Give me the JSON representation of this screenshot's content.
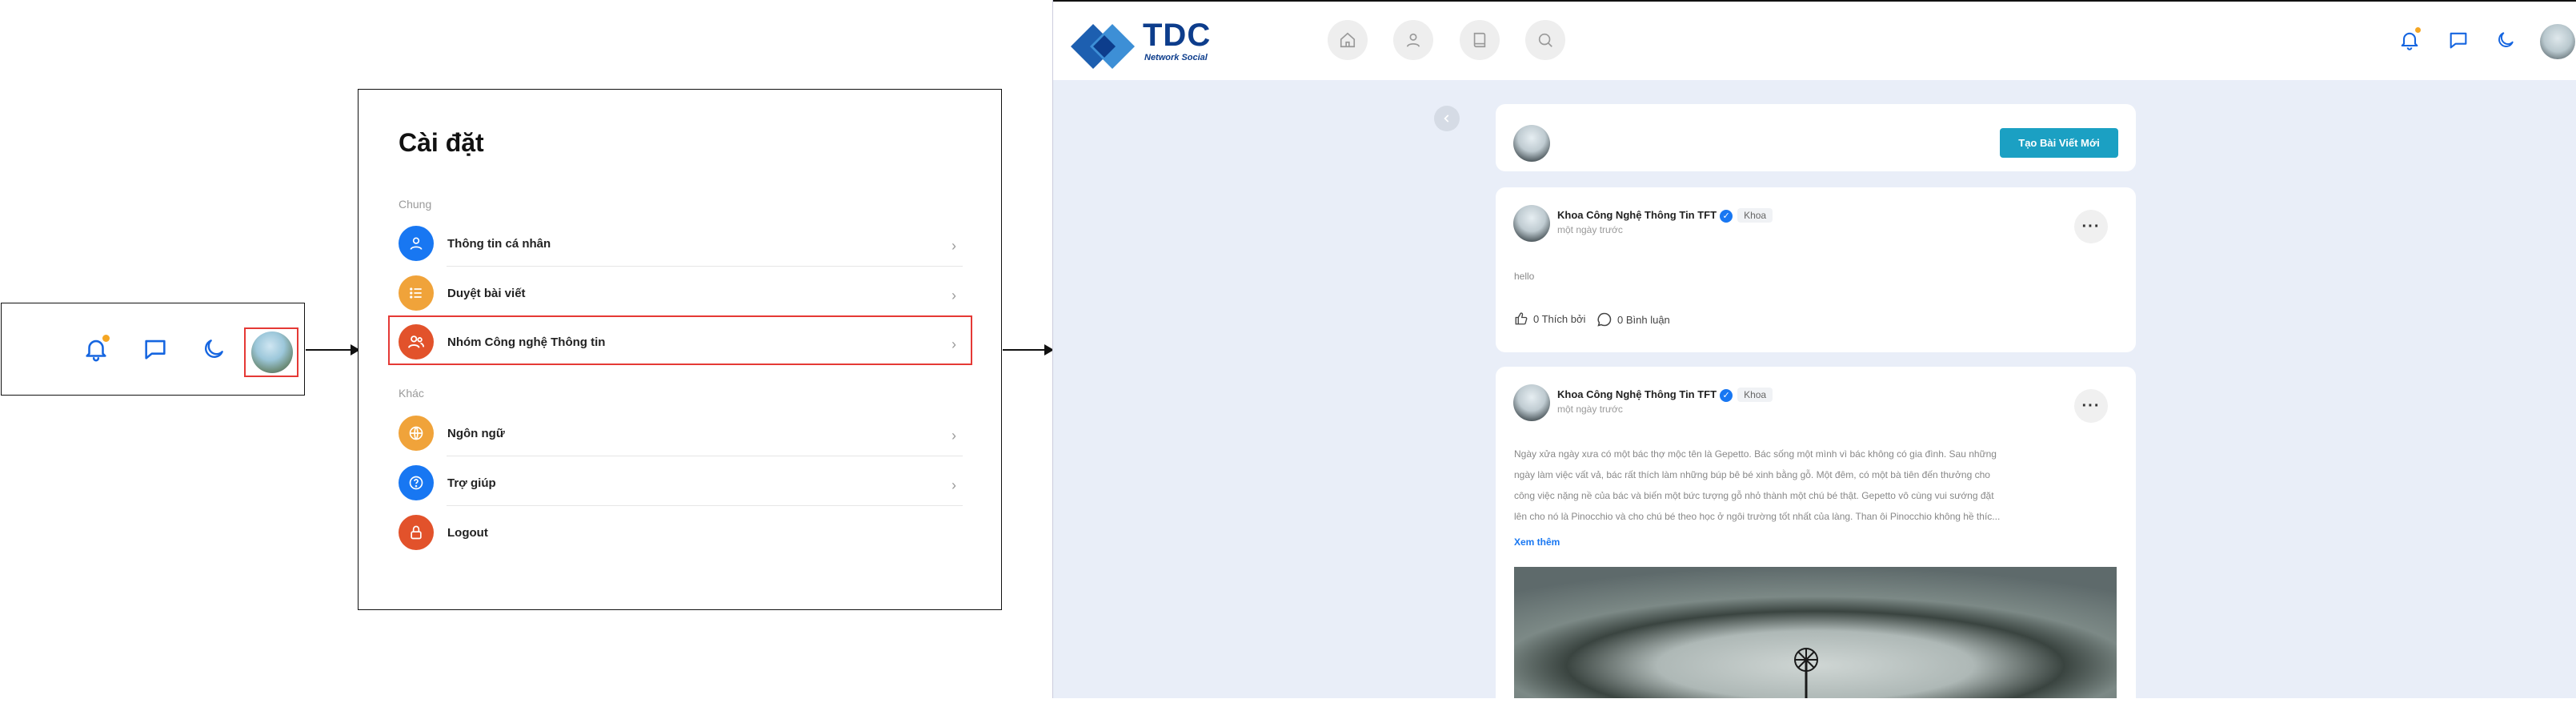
{
  "header_icons": {
    "icons": [
      "bell-icon",
      "chat-icon",
      "moon-icon"
    ],
    "notification_dot_color": "#f5a623",
    "accent": "#1565e0"
  },
  "settings": {
    "title": "Cài đặt",
    "section_general": "Chung",
    "section_other": "Khác",
    "items": [
      {
        "label": "Thông tin cá nhân",
        "icon": "user-icon",
        "color": "#1877f2"
      },
      {
        "label": "Duyệt bài viết",
        "icon": "list-icon",
        "color": "#f0a33a"
      },
      {
        "label": "Nhóm Công nghệ Thông tin",
        "icon": "group-icon",
        "color": "#e2522b"
      },
      {
        "label": "Ngôn ngữ",
        "icon": "globe-icon",
        "color": "#f0a33a"
      },
      {
        "label": "Trợ giúp",
        "icon": "help-icon",
        "color": "#1877f2"
      },
      {
        "label": "Logout",
        "icon": "lock-icon",
        "color": "#e2522b"
      }
    ]
  },
  "app": {
    "logo_text": "TDC",
    "logo_sub": "Network Social",
    "nav": [
      "home-icon",
      "user-icon",
      "book-icon",
      "search-icon"
    ],
    "create_post_label": "Tạo Bài Viết Mới",
    "posts": [
      {
        "author": "Khoa Công Nghệ Thông Tin TFT",
        "role": "Khoa",
        "time": "một ngày trước",
        "text": "hello",
        "likes": "0 Thích bởi",
        "comments": "0 Bình luận"
      },
      {
        "author": "Khoa Công Nghệ Thông Tin TFT",
        "role": "Khoa",
        "time": "một ngày trước",
        "lines": [
          "Ngày xửa ngày xưa có một bác thợ mộc tên là Gepetto. Bác sống một mình vì bác không có gia đình. Sau những",
          "ngày làm việc vất vả, bác rất thích làm những búp bê bé xinh bằng gỗ. Một đêm, có một bà tiên đến thưởng cho",
          "công việc nặng nề của bác và biến một bức tượng gỗ nhỏ thành một chú bé thật. Gepetto vô cùng vui sướng đặt",
          "lên cho nó là Pinocchio và cho chú bé theo học ở ngôi trường tốt nhất của làng. Than ôi Pinocchio không hề thíc..."
        ],
        "see_more": "Xem thêm"
      }
    ]
  }
}
